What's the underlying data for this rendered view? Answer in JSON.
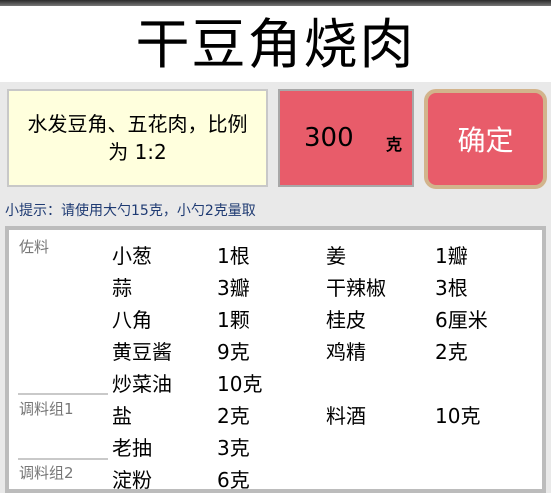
{
  "title": "干豆角烧肉",
  "ingredient_text": "水发豆角、五花肉，比例为 1:2",
  "amount": {
    "value": "300",
    "unit": "克"
  },
  "confirm_label": "确定",
  "tip": "小提示：请使用大勺15克，小勺2克量取",
  "groups": [
    {
      "label": "佐料",
      "rows": [
        [
          {
            "name": "小葱",
            "qty": "1根"
          },
          {
            "name": "姜",
            "qty": "1瓣"
          }
        ],
        [
          {
            "name": "蒜",
            "qty": "3瓣"
          },
          {
            "name": "干辣椒",
            "qty": "3根"
          }
        ],
        [
          {
            "name": "八角",
            "qty": "1颗"
          },
          {
            "name": "桂皮",
            "qty": "6厘米"
          }
        ],
        [
          {
            "name": "黄豆酱",
            "qty": "9克"
          },
          {
            "name": "鸡精",
            "qty": "2克"
          }
        ],
        [
          {
            "name": "炒菜油",
            "qty": "10克"
          }
        ]
      ]
    },
    {
      "label": "调料组1",
      "rows": [
        [
          {
            "name": "盐",
            "qty": "2克"
          },
          {
            "name": "料酒",
            "qty": "10克"
          }
        ],
        [
          {
            "name": "老抽",
            "qty": "3克"
          }
        ]
      ]
    },
    {
      "label": "调料组2",
      "rows": [
        [
          {
            "name": "淀粉",
            "qty": "6克"
          }
        ]
      ]
    }
  ]
}
